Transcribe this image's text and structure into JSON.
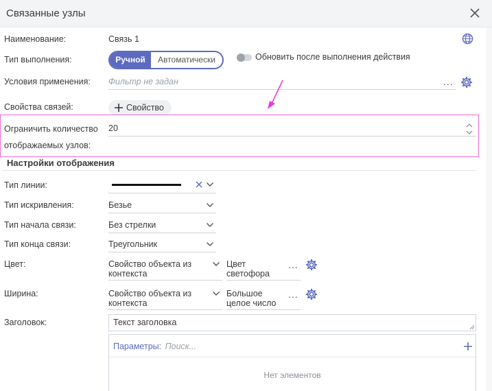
{
  "dialog": {
    "title": "Связанные узлы"
  },
  "fields": {
    "name_label": "Наименование:",
    "name_value": "Связь 1",
    "exec_type_label": "Тип выполнения:",
    "exec_manual": "Ручной",
    "exec_auto": "Автоматически",
    "refresh_after": "Обновить после выполнения действия",
    "conditions_label": "Условия применения:",
    "conditions_placeholder": "Фильтр не задан",
    "link_props_label": "Свойства связей:",
    "add_property": "Свойство",
    "limit_label_line1": "Ограничить количество",
    "limit_label_line2": "отображаемых узлов:",
    "limit_value": "20"
  },
  "display": {
    "section_title": "Настройки отображения",
    "line_type_label": "Тип линии:",
    "curve_type_label": "Тип искривления:",
    "curve_type_value": "Безье",
    "start_type_label": "Тип начала связи:",
    "start_type_value": "Без стрелки",
    "end_type_label": "Тип конца связи:",
    "end_type_value": "Треугольник",
    "color_label": "Цвет:",
    "color_source_line1": "Свойство объекта из",
    "color_source_line2": "контекста",
    "color_value_line1": "Цвет",
    "color_value_line2": "светофора",
    "width_label": "Ширина:",
    "width_source_line1": "Свойство объекта из",
    "width_source_line2": "контекста",
    "width_value_line1": "Большое",
    "width_value_line2": "целое число",
    "caption_label": "Заголовок:",
    "caption_value": "Текст заголовка"
  },
  "params": {
    "label": "Параметры:",
    "search_placeholder": "Поиск...",
    "empty_text": "Нет элементов"
  },
  "dots": "...",
  "colors": {
    "accent": "#5c6bc0",
    "highlight": "#ea6ad8"
  }
}
